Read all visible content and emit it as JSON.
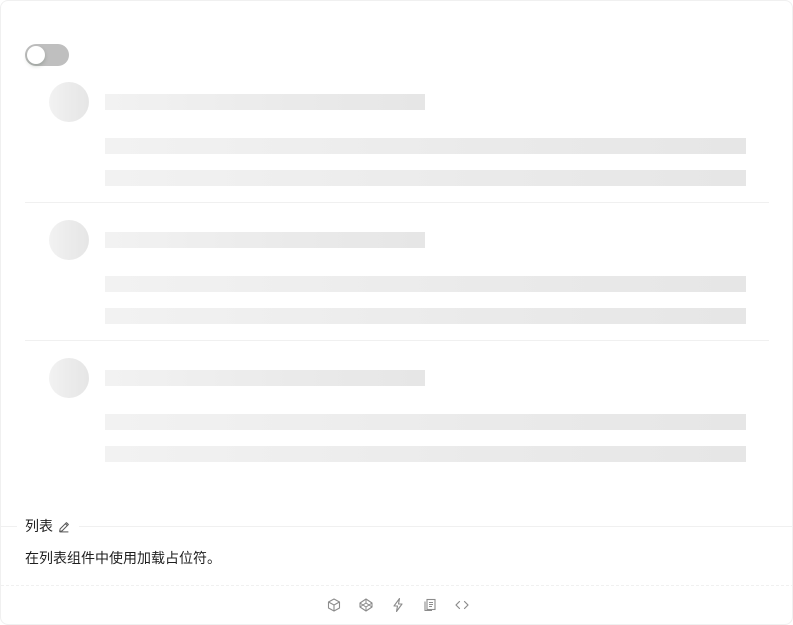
{
  "loading_switch": {
    "checked": false
  },
  "skeleton_list": {
    "item_count": 3
  },
  "section": {
    "title": "列表",
    "description": "在列表组件中使用加载占位符。",
    "title_icon": "edit-icon"
  },
  "actions": [
    {
      "icon": "codesandbox-icon"
    },
    {
      "icon": "codepen-icon"
    },
    {
      "icon": "stackblitz-icon"
    },
    {
      "icon": "copy-icon"
    },
    {
      "icon": "code-icon"
    }
  ],
  "colors": {
    "switch_off": "#bfbfbf",
    "skeleton": "#eeeeee",
    "divider": "#f0f0f0",
    "icon": "#8c8c8c"
  }
}
